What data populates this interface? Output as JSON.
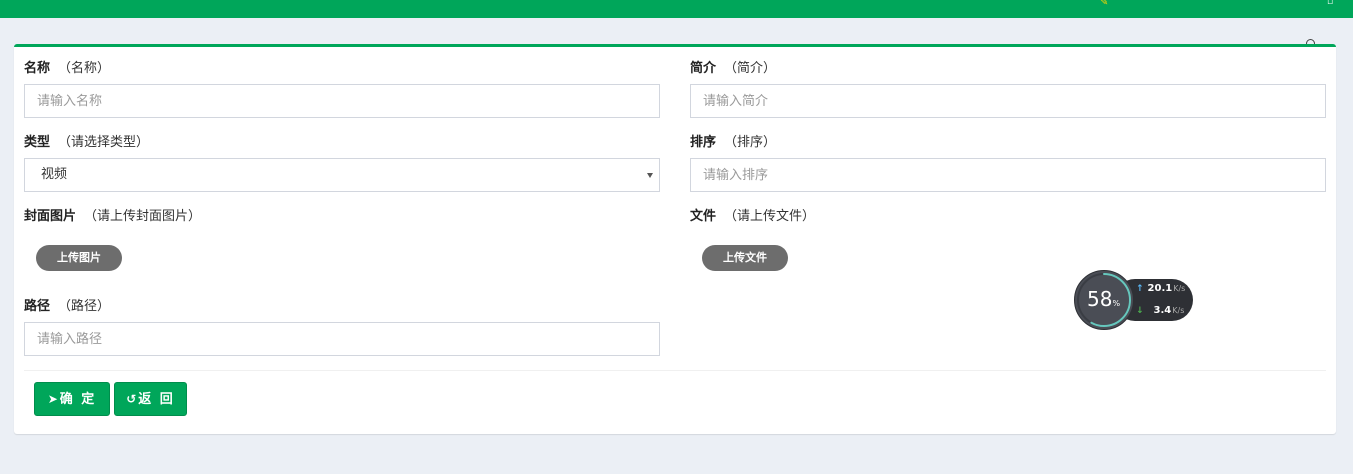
{
  "form": {
    "name": {
      "label": "名称",
      "hint": "（名称）",
      "placeholder": "请输入名称"
    },
    "intro": {
      "label": "简介",
      "hint": "（简介）",
      "placeholder": "请输入简介"
    },
    "type": {
      "label": "类型",
      "hint": "（请选择类型）",
      "value": "视频"
    },
    "sort": {
      "label": "排序",
      "hint": "（排序）",
      "placeholder": "请输入排序"
    },
    "cover": {
      "label": "封面图片",
      "hint": "（请上传封面图片）",
      "button": "上传图片"
    },
    "file": {
      "label": "文件",
      "hint": "（请上传文件）",
      "button": "上传文件"
    },
    "path": {
      "label": "路径",
      "hint": "（路径）",
      "placeholder": "请输入路径"
    }
  },
  "actions": {
    "confirm": "确 定",
    "back": "返 回"
  },
  "netmon": {
    "percent": "58",
    "percent_sign": "%",
    "upload": "20.1",
    "download": "3.4",
    "unit": "K/s",
    "cpu_fraction": 0.58
  },
  "colors": {
    "brand": "#00a65a",
    "pill": "#6d6d6d"
  },
  "icons": {
    "confirm": "paper-plane-icon",
    "back": "history-icon",
    "topbar": "search-icon"
  }
}
